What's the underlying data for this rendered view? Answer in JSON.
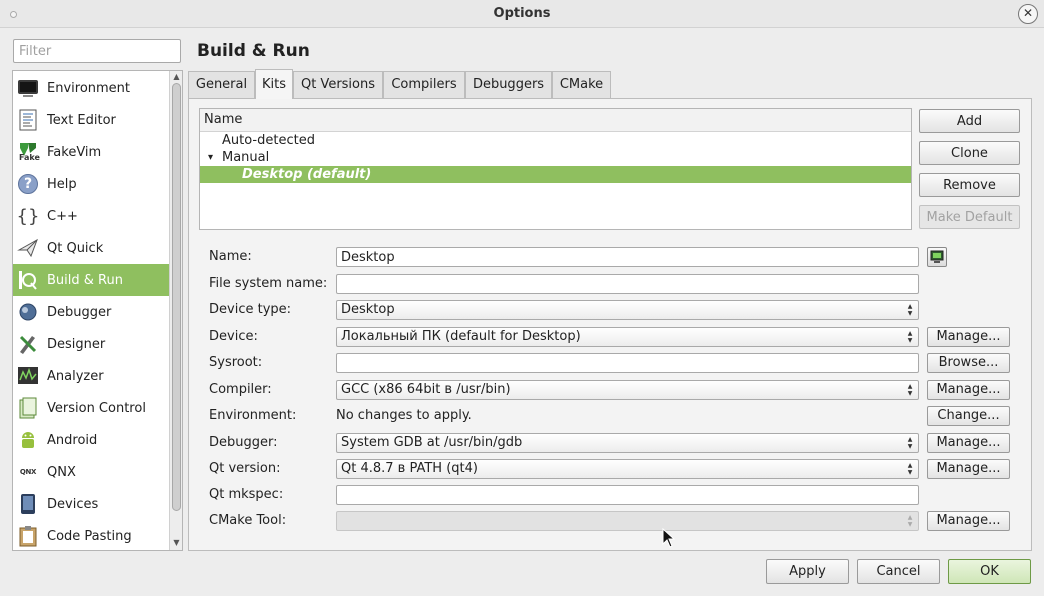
{
  "window": {
    "title": "Options",
    "close_glyph": "✕"
  },
  "filter": {
    "placeholder": "Filter",
    "value": ""
  },
  "sidebar": {
    "items": [
      {
        "label": "Environment",
        "icon": "monitor-icon"
      },
      {
        "label": "Text Editor",
        "icon": "text-document-icon"
      },
      {
        "label": "FakeVim",
        "icon": "fakevim-icon",
        "icon_text": "Fake"
      },
      {
        "label": "Help",
        "icon": "help-icon",
        "icon_text": "?"
      },
      {
        "label": "C++",
        "icon": "braces-icon",
        "icon_text": "{}"
      },
      {
        "label": "Qt Quick",
        "icon": "paper-plane-icon"
      },
      {
        "label": "Build & Run",
        "icon": "build-run-icon",
        "selected": true
      },
      {
        "label": "Debugger",
        "icon": "bug-icon"
      },
      {
        "label": "Designer",
        "icon": "designer-tools-icon"
      },
      {
        "label": "Analyzer",
        "icon": "oscilloscope-icon"
      },
      {
        "label": "Version Control",
        "icon": "version-control-icon"
      },
      {
        "label": "Android",
        "icon": "android-icon"
      },
      {
        "label": "QNX",
        "icon": "qnx-logo-icon",
        "icon_text": "QNX"
      },
      {
        "label": "Devices",
        "icon": "devices-icon"
      },
      {
        "label": "Code Pasting",
        "icon": "clipboard-icon"
      }
    ]
  },
  "page": {
    "title": "Build & Run"
  },
  "tabs": [
    {
      "label": "General"
    },
    {
      "label": "Kits",
      "active": true
    },
    {
      "label": "Qt Versions"
    },
    {
      "label": "Compilers"
    },
    {
      "label": "Debuggers"
    },
    {
      "label": "CMake"
    }
  ],
  "kit_tree": {
    "header": "Name",
    "rows": [
      {
        "label": "Auto-detected",
        "expander": ""
      },
      {
        "label": "Manual",
        "expander": "▾"
      },
      {
        "label": "Desktop (default)",
        "expander": "",
        "selected": true
      }
    ]
  },
  "kit_buttons": {
    "add": "Add",
    "clone": "Clone",
    "remove": "Remove",
    "make_default": "Make Default"
  },
  "form": {
    "name": {
      "label": "Name:",
      "value": "Desktop"
    },
    "fs_name": {
      "label": "File system name:",
      "value": ""
    },
    "device_type": {
      "label": "Device type:",
      "value": "Desktop"
    },
    "device": {
      "label": "Device:",
      "value": "Локальный ПК (default for Desktop)",
      "button": "Manage..."
    },
    "sysroot": {
      "label": "Sysroot:",
      "value": "",
      "button": "Browse..."
    },
    "compiler": {
      "label": "Compiler:",
      "value": "GCC (x86 64bit в /usr/bin)",
      "button": "Manage..."
    },
    "environment": {
      "label": "Environment:",
      "value": "No changes to apply.",
      "button": "Change..."
    },
    "debugger": {
      "label": "Debugger:",
      "value": "System GDB at /usr/bin/gdb",
      "button": "Manage..."
    },
    "qt_version": {
      "label": "Qt version:",
      "value": "Qt 4.8.7 в PATH (qt4)",
      "button": "Manage..."
    },
    "qt_mkspec": {
      "label": "Qt mkspec:",
      "value": ""
    },
    "cmake_tool": {
      "label": "CMake Tool:",
      "value": "",
      "button": "Manage..."
    }
  },
  "footer": {
    "apply": "Apply",
    "cancel": "Cancel",
    "ok": "OK"
  },
  "colors": {
    "accent": "#8fbf5f",
    "background": "#ededed"
  }
}
